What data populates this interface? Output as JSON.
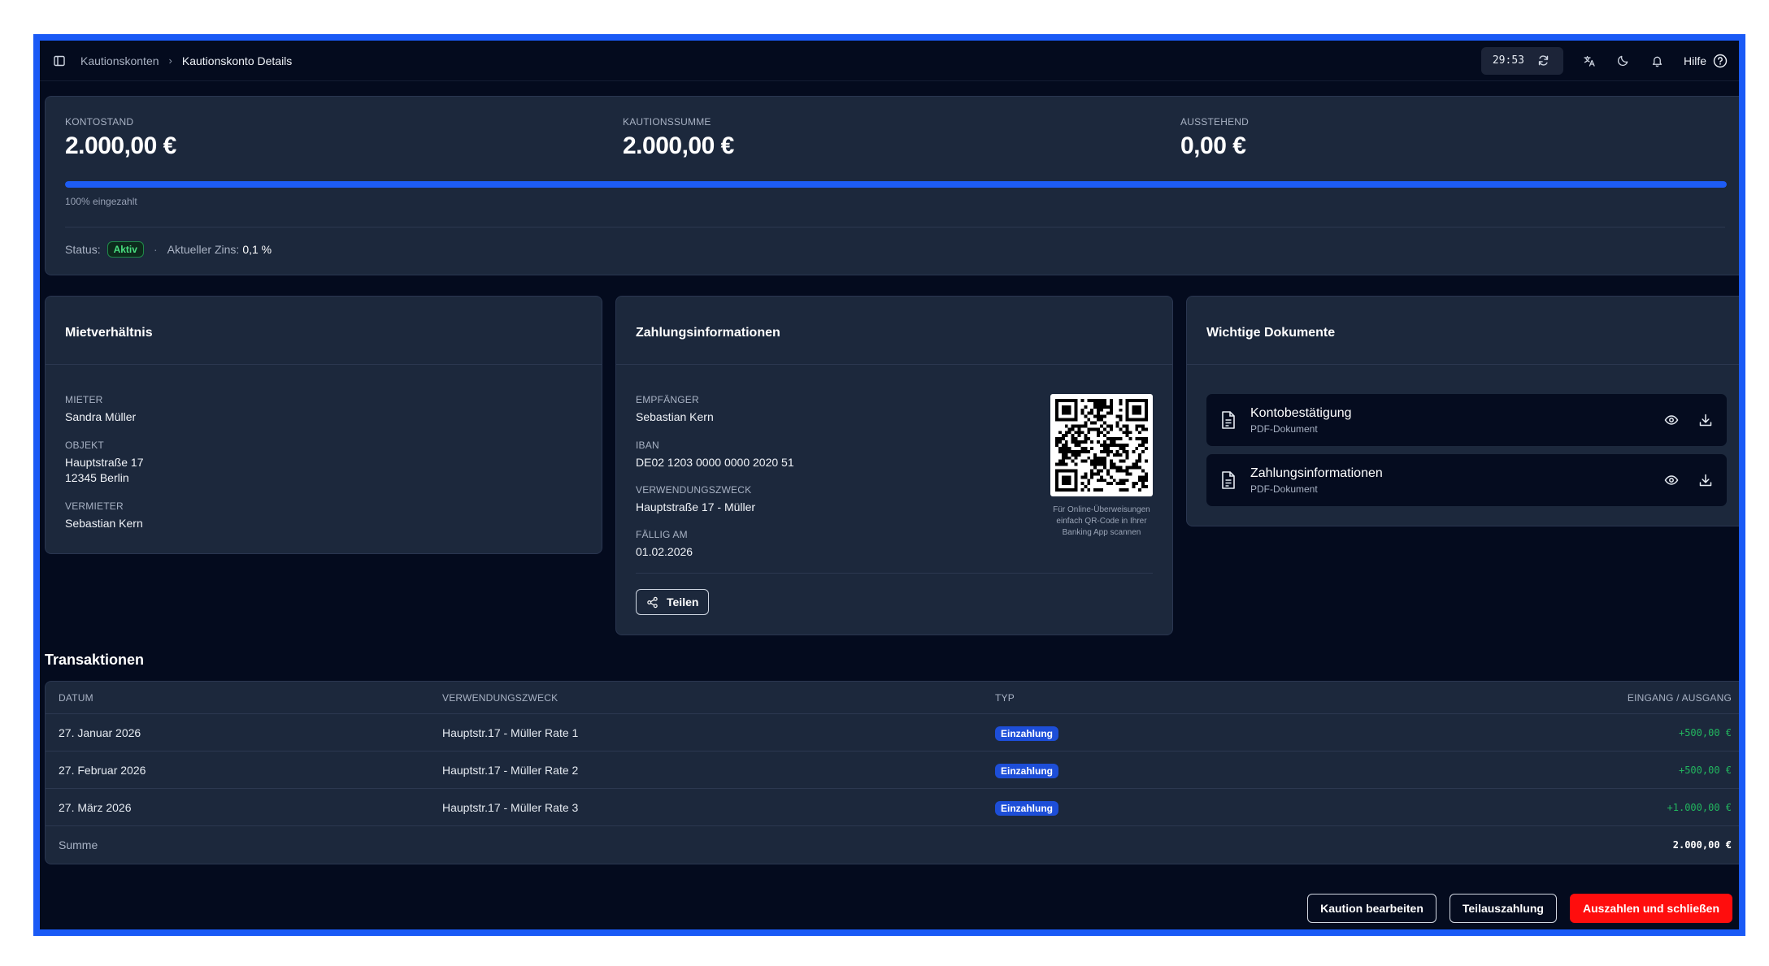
{
  "breadcrumb": {
    "parent": "Kautionskonten",
    "current": "Kautionskonto Details"
  },
  "topbar": {
    "timer": "29:53",
    "help_label": "Hilfe",
    "icons": [
      "sidebar-toggle-icon",
      "refresh-icon",
      "translate-icon",
      "moon-icon",
      "bell-icon",
      "help-circle-icon"
    ]
  },
  "summary": {
    "kontostand_label": "KONTOSTAND",
    "kontostand_value": "2.000,00 €",
    "kautionssumme_label": "KAUTIONSSUMME",
    "kautionssumme_value": "2.000,00 €",
    "ausstehend_label": "AUSSTEHEND",
    "ausstehend_value": "0,00 €",
    "progress_percent": 100,
    "progress_text": "100% eingezahlt",
    "status_label": "Status:",
    "status_value": "Aktiv",
    "zins_label": "Aktueller Zins:",
    "zins_value": "0,1 %"
  },
  "mietverhaeltnis": {
    "title": "Mietverhältnis",
    "mieter_label": "MIETER",
    "mieter_value": "Sandra Müller",
    "objekt_label": "OBJEKT",
    "objekt_line1": "Hauptstraße 17",
    "objekt_line2": "12345 Berlin",
    "vermieter_label": "VERMIETER",
    "vermieter_value": "Sebastian Kern"
  },
  "zahlung": {
    "title": "Zahlungsinformationen",
    "empfaenger_label": "EMPFÄNGER",
    "empfaenger_value": "Sebastian Kern",
    "iban_label": "IBAN",
    "iban_value": "DE02 1203 0000 0000 2020 51",
    "zweck_label": "VERWENDUNGSZWECK",
    "zweck_value": "Hauptstraße 17 - Müller",
    "faellig_label": "FÄLLIG AM",
    "faellig_value": "01.02.2026",
    "qr_caption": "Für Online-Überweisungen einfach QR-Code in Ihrer Banking App scannen",
    "share_label": "Teilen"
  },
  "dokumente": {
    "title": "Wichtige Dokumente",
    "items": [
      {
        "title": "Kontobestätigung",
        "subtitle": "PDF-Dokument"
      },
      {
        "title": "Zahlungsinformationen",
        "subtitle": "PDF-Dokument"
      }
    ]
  },
  "transaktionen": {
    "title": "Transaktionen",
    "headers": [
      "DATUM",
      "VERWENDUNGSZWECK",
      "TYP",
      "EINGANG / AUSGANG"
    ],
    "rows": [
      {
        "datum": "27. Januar 2026",
        "zweck": "Hauptstr.17 - Müller Rate 1",
        "typ": "Einzahlung",
        "betrag": "+500,00 €"
      },
      {
        "datum": "27. Februar 2026",
        "zweck": "Hauptstr.17 - Müller Rate 2",
        "typ": "Einzahlung",
        "betrag": "+500,00 €"
      },
      {
        "datum": "27. März 2026",
        "zweck": "Hauptstr.17 - Müller Rate 3",
        "typ": "Einzahlung",
        "betrag": "+1.000,00 €"
      }
    ],
    "sum_label": "Summe",
    "sum_value": "2.000,00 €"
  },
  "actions": {
    "edit_label": "Kaution bearbeiten",
    "partial_label": "Teilauszahlung",
    "payout_label": "Auszahlen und schließen"
  },
  "colors": {
    "frame": "#1a5af6",
    "background": "#040b1e",
    "card": "#1c283c",
    "accent": "#1d5cf5",
    "success": "#22b55e",
    "danger": "#ff0d0d"
  }
}
